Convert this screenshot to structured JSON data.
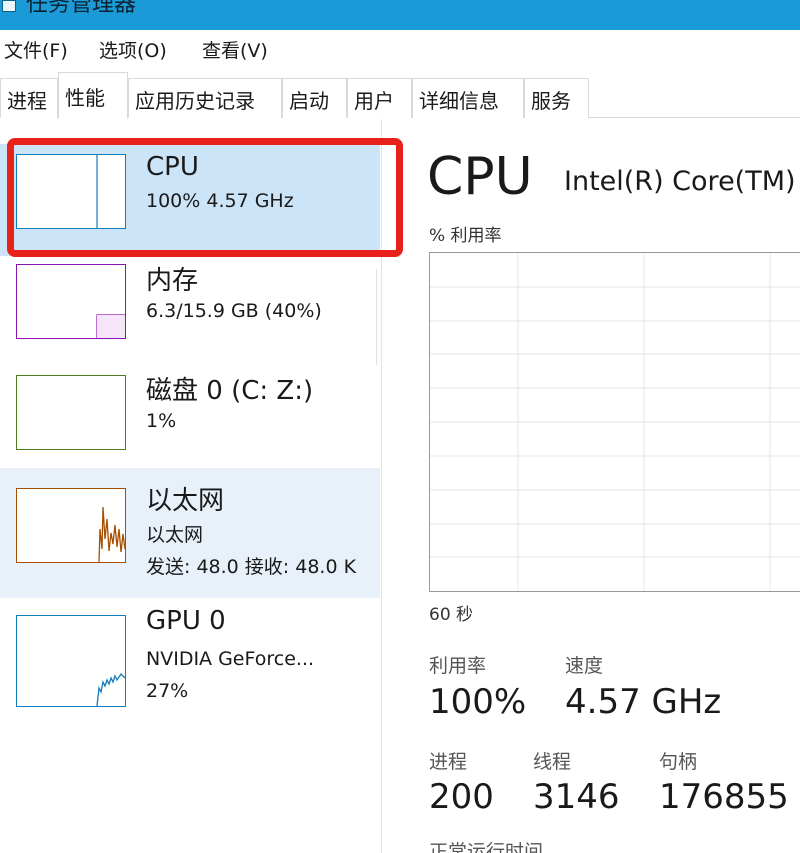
{
  "window": {
    "title": "任务管理器"
  },
  "menu": [
    "文件(F)",
    "选项(O)",
    "查看(V)"
  ],
  "tabs": [
    "进程",
    "性能",
    "应用历史记录",
    "启动",
    "用户",
    "详细信息",
    "服务"
  ],
  "sidebar": {
    "cpu": {
      "title": "CPU",
      "sub": "100%  4.57 GHz"
    },
    "memory": {
      "title": "内存",
      "sub": "6.3/15.9 GB (40%)",
      "usage_fraction": 0.4
    },
    "disk": {
      "title": "磁盘 0 (C: Z:)",
      "sub": "1%"
    },
    "ethernet": {
      "title": "以太网",
      "sub1": "以太网",
      "sub2": "发送: 48.0  接收: 48.0 K"
    },
    "gpu": {
      "title": "GPU 0",
      "sub1": "NVIDIA GeForce...",
      "sub2": "27%"
    }
  },
  "main": {
    "title": "CPU",
    "model": "Intel(R) Core(TM)",
    "util_label": "% 利用率",
    "axis_left": "60 秒",
    "stats": {
      "util_label": "利用率",
      "util_value": "100%",
      "speed_label": "速度",
      "speed_value": "4.57 GHz",
      "proc_label": "进程",
      "proc_value": "200",
      "thread_label": "线程",
      "thread_value": "3146",
      "handle_label": "句柄",
      "handle_value": "176855",
      "uptime_label": "正常运行时间"
    }
  },
  "colors": {
    "titlebar": "#1a9ad6",
    "selected": "#cce4f7",
    "highlight": "#e8221b",
    "cpu_line": "#117dbb",
    "mem_line": "#8b12ae",
    "eth_line": "#a74f01"
  }
}
